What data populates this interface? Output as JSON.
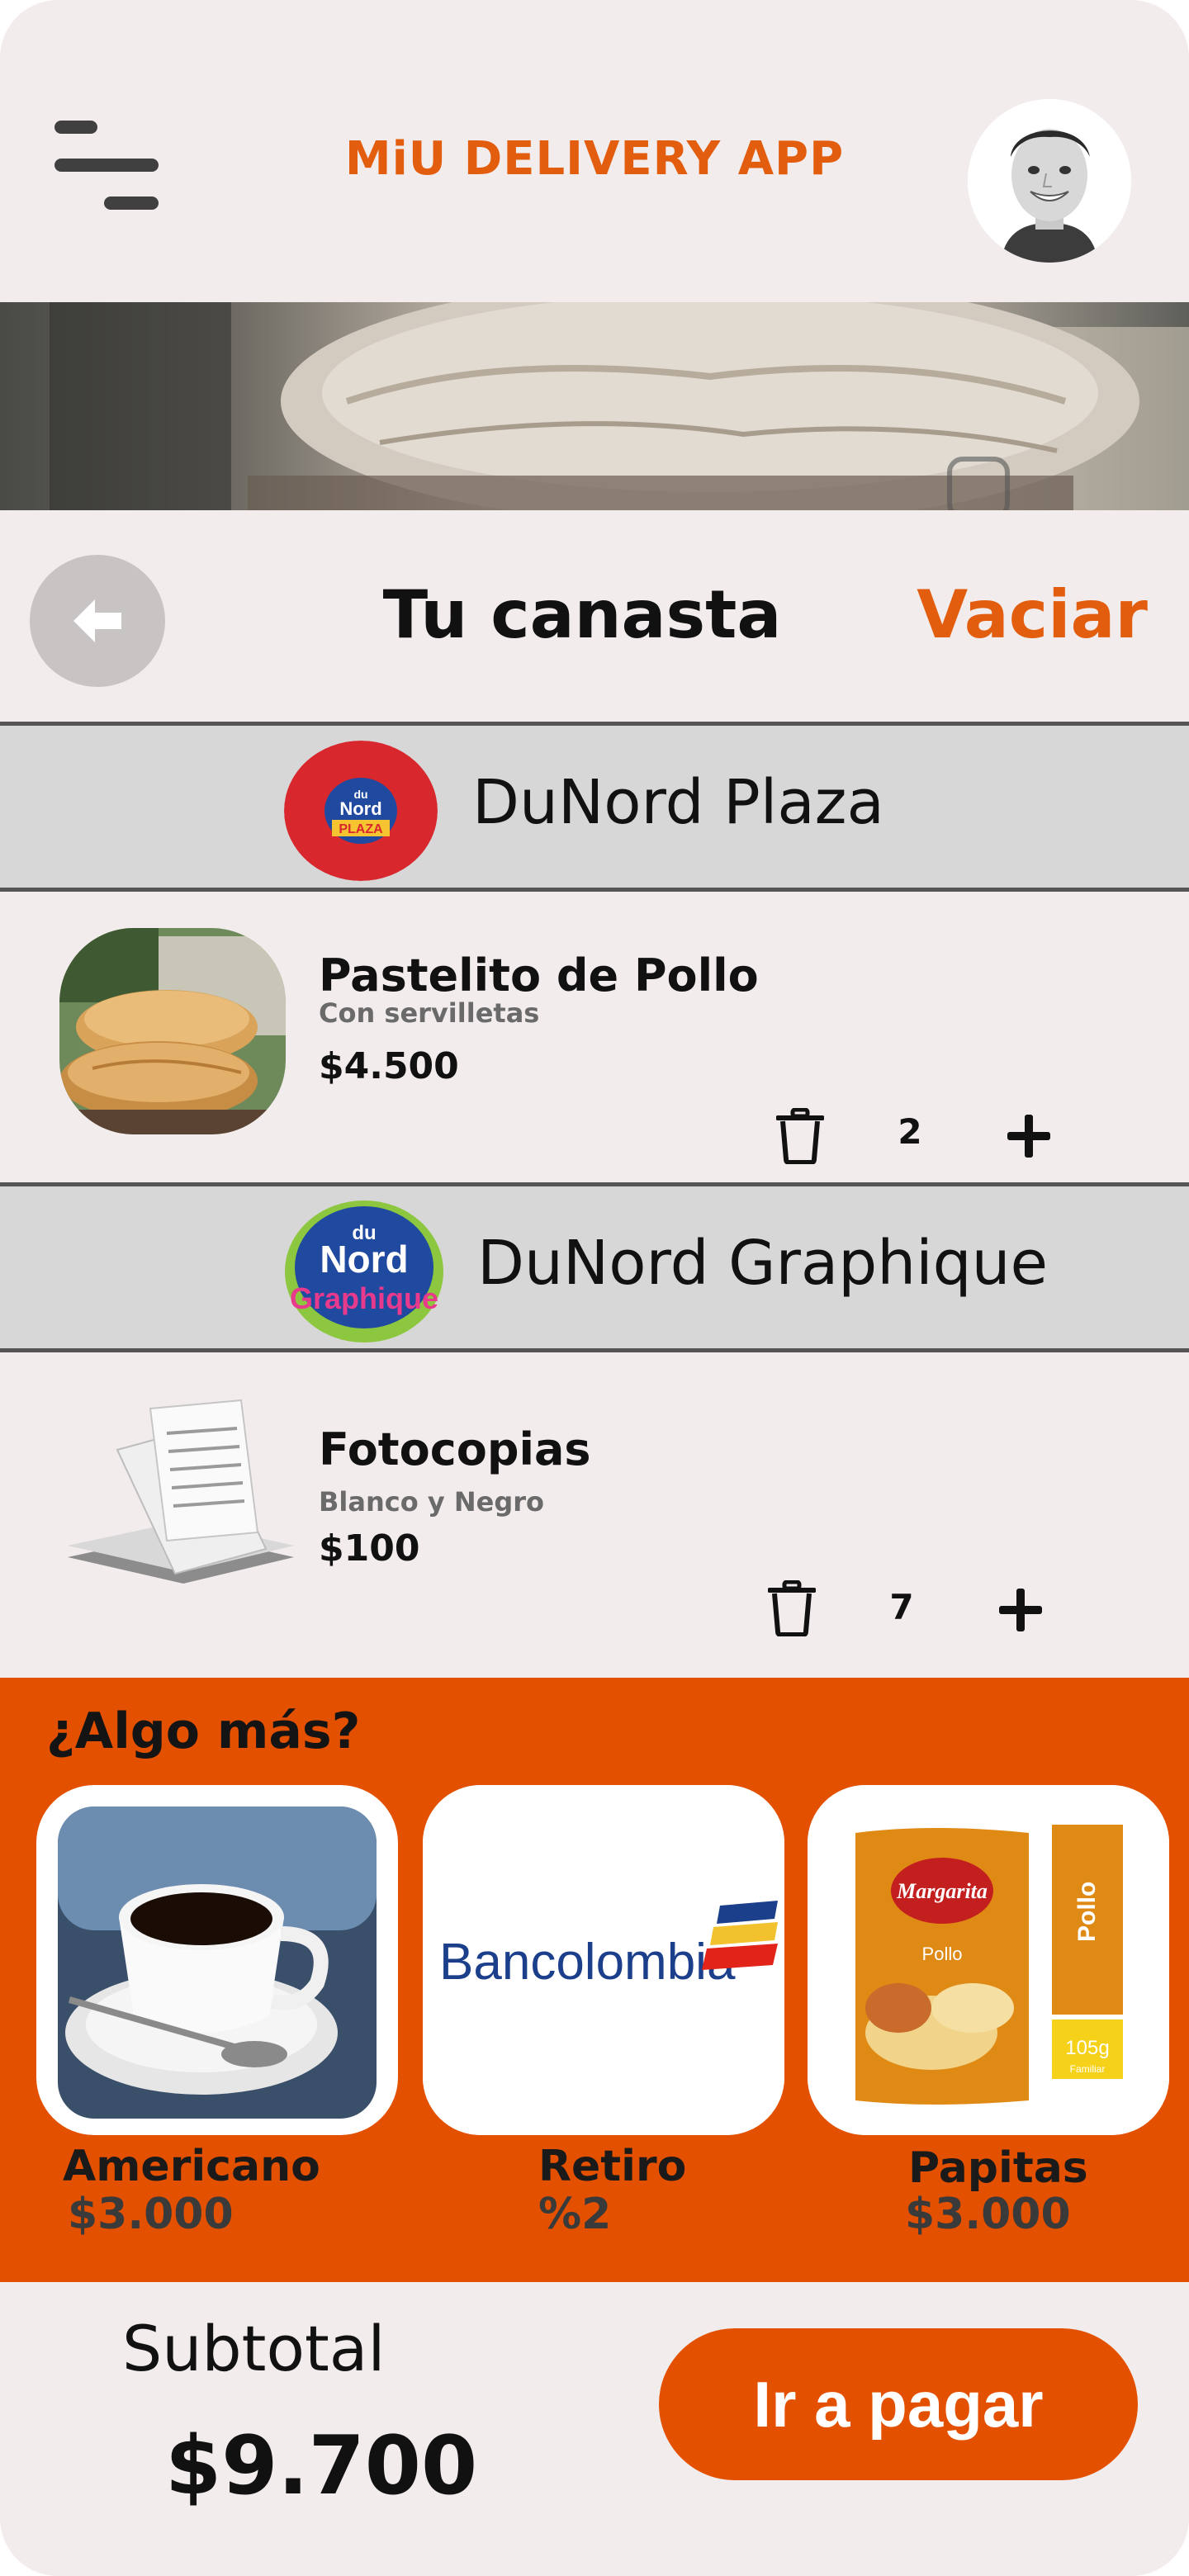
{
  "header": {
    "menu_icon": "hamburger-menu-icon",
    "title": "MiU DELIVERY APP",
    "avatar_icon": "user-avatar"
  },
  "basket": {
    "back_icon": "arrow-left-icon",
    "title": "Tu canasta",
    "empty_label": "Vaciar"
  },
  "stores": [
    {
      "name": "DuNord Plaza",
      "logo_text": [
        "du",
        "Nord",
        "PLAZA"
      ],
      "items": [
        {
          "name": "Pastelito de Pollo",
          "note": "Con servilletas",
          "price": "$4.500",
          "quantity": "2"
        }
      ]
    },
    {
      "name": "DuNord Graphique",
      "logo_text": [
        "du",
        "Nord",
        "Graphique"
      ],
      "items": [
        {
          "name": "Fotocopias",
          "note": "Blanco y Negro",
          "price": "$100",
          "quantity": "7"
        }
      ]
    }
  ],
  "upsell": {
    "title": "¿Algo más?",
    "cards": [
      {
        "name": "Americano",
        "price": "$3.000",
        "image": "coffee-cup"
      },
      {
        "name": "Retiro",
        "price": "%2",
        "image": "bank-logo",
        "logo_text": "Bancolombia"
      },
      {
        "name": "Papitas",
        "price": "$3.000",
        "image": "chips-bag",
        "pack_text": [
          "Margarita",
          "Pollo",
          "Pollo",
          "105g",
          "Familiar"
        ]
      }
    ]
  },
  "footer": {
    "subtotal_label": "Subtotal",
    "subtotal_value": "$9.700",
    "pay_label": "Ir a pagar"
  },
  "colors": {
    "accent": "#e35d0e",
    "upsell_bg": "#e35100",
    "page_bg": "#f2ecec",
    "store_bar": "#d7d7d7"
  }
}
